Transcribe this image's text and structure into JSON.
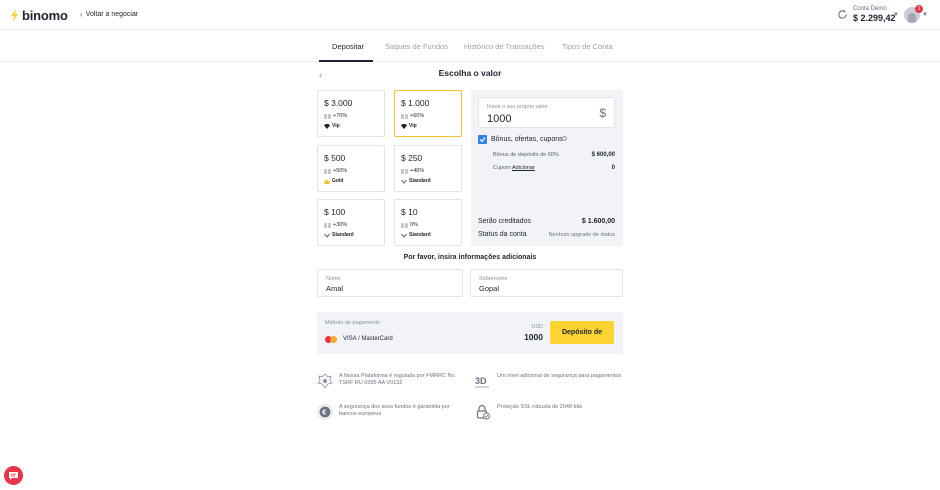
{
  "header": {
    "brand": "binomo",
    "back_label": "Voltar a negociar",
    "account_label": "Conta Demo",
    "account_balance": "$ 2.299,42",
    "notification_count": "1"
  },
  "tabs": [
    {
      "label": "Depositar",
      "active": true
    },
    {
      "label": "Saques de Fundos",
      "active": false
    },
    {
      "label": "Histórico de Transações",
      "active": false
    },
    {
      "label": "Tipos de Conta",
      "active": false
    }
  ],
  "chooser": {
    "title": "Escolha o valor",
    "amounts": [
      {
        "value": "$ 3.000",
        "bonus": "+70%",
        "tier": "Vip",
        "selected": false
      },
      {
        "value": "$ 1.000",
        "bonus": "+60%",
        "tier": "Vip",
        "selected": true
      },
      {
        "value": "$ 500",
        "bonus": "+50%",
        "tier": "Gold",
        "selected": false
      },
      {
        "value": "$ 250",
        "bonus": "+40%",
        "tier": "Standard",
        "selected": false
      },
      {
        "value": "$ 100",
        "bonus": "+30%",
        "tier": "Standard",
        "selected": false
      },
      {
        "value": "$ 10",
        "bonus": "0%",
        "tier": "Standard",
        "selected": false
      }
    ]
  },
  "summary": {
    "input_label": "Insira o seu próprio valor",
    "input_value": "1000",
    "currency_symbol": "$",
    "bonus_checkbox_label": "Bônus, ofertas, cupons",
    "bonus_checked": true,
    "deposit_bonus_label": "Bônus de depósito de 60%",
    "deposit_bonus_value": "$ 600,00",
    "coupon_label": "Cupom",
    "coupon_link": "Adicionar",
    "coupon_value": "0",
    "credited_label": "Serão creditados",
    "credited_value": "$ 1.600,00",
    "status_label": "Status da conta",
    "status_value": "Nenhum upgrade de status"
  },
  "additional": {
    "title": "Por favor, insira informações adicionais",
    "first_name_label": "Nome",
    "first_name_value": "Amal",
    "last_name_label": "Sobrenome",
    "last_name_value": "Gopal"
  },
  "payment": {
    "label": "Método de pagamento",
    "method": "VISA / MasterCard",
    "currency": "USD",
    "amount": "1000",
    "button_label": "Depósito de"
  },
  "trust": [
    {
      "icon": "regulator-emblem-icon",
      "text": "A Nossa Plataforma é regulada por FMRRC No. TSRF RU 0395 AA V0132"
    },
    {
      "icon": "3d-secure-icon",
      "text": "Um nível adicional de segurança para pagamentos"
    },
    {
      "icon": "euro-coin-icon",
      "text": "A segurança dos seus fundos é garantida por bancos europeus"
    },
    {
      "icon": "ssl-lock-icon",
      "text": "Proteção SSL robusta de 2048 bits"
    }
  ],
  "colors": {
    "accent_yellow": "#fcd535",
    "selected_border": "#f1c232",
    "checkbox_blue": "#2f80ed",
    "badge_red": "#e8354b"
  }
}
